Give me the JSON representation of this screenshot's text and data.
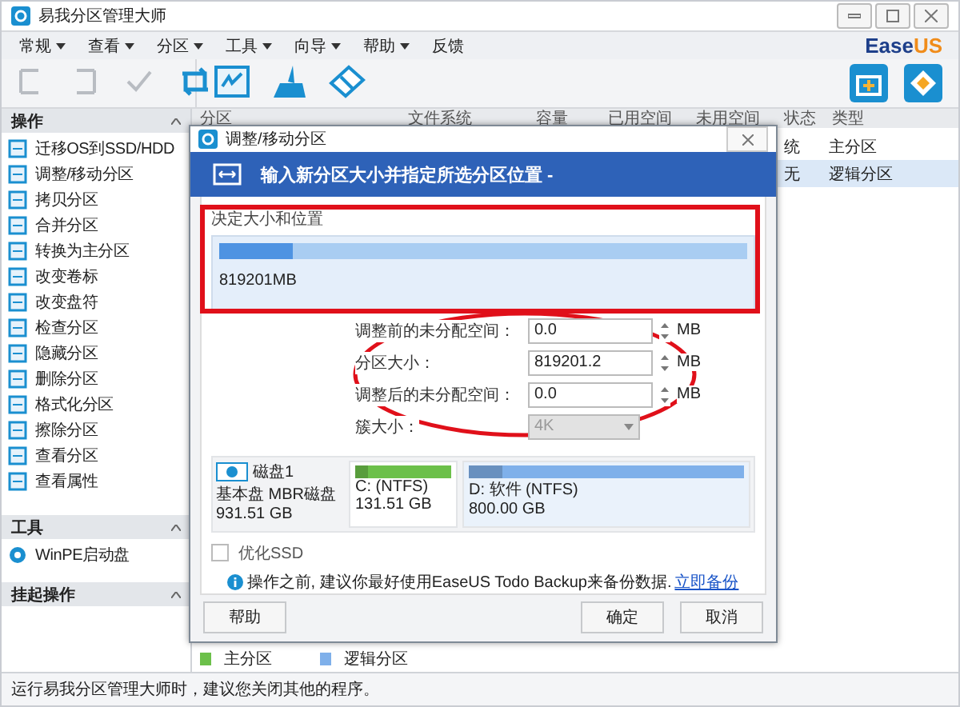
{
  "window": {
    "title": "易我分区管理大师"
  },
  "menu": [
    "常规",
    "查看",
    "分区",
    "工具",
    "向导",
    "帮助",
    "反馈"
  ],
  "logo": {
    "main": "Ease",
    "accent": "US"
  },
  "toolbar": [
    {
      "kind": "undo",
      "disabled": true
    },
    {
      "kind": "redo",
      "disabled": true
    },
    {
      "kind": "apply",
      "disabled": true
    },
    {
      "kind": "refresh",
      "disabled": false
    },
    {
      "kind": "migrate",
      "disabled": false
    },
    {
      "kind": "clean",
      "disabled": false
    },
    {
      "kind": "wipe",
      "disabled": false
    }
  ],
  "sidebar": [
    {
      "title": "操作",
      "items": [
        "迁移OS到SSD/HDD",
        "调整/移动分区",
        "拷贝分区",
        "合并分区",
        "转换为主分区",
        "改变卷标",
        "改变盘符",
        "检查分区",
        "隐藏分区",
        "删除分区",
        "格式化分区",
        "擦除分区",
        "查看分区",
        "查看属性"
      ]
    },
    {
      "title": "工具",
      "items": [
        "WinPE启动盘"
      ]
    },
    {
      "title": "挂起操作"
    }
  ],
  "table": {
    "columns": [
      "分区",
      "文件系统",
      "容量",
      "已用空间",
      "未用空间",
      "状态",
      "类型"
    ],
    "rows": [
      {
        "status": "统",
        "type": "主分区",
        "selected": false
      },
      {
        "status": "无",
        "type": "逻辑分区",
        "selected": true
      }
    ]
  },
  "legend": [
    {
      "label": "主分区",
      "color": "#6cc04a"
    },
    {
      "label": "逻辑分区",
      "color": "#7fb0ea"
    }
  ],
  "status_bar": "运行易我分区管理大师时，建议您关闭其他的程序。",
  "dialog": {
    "title": "调整/移动分区",
    "banner": "输入新分区大小并指定所选分区位置 -",
    "group_title": "决定大小和位置",
    "partition_bar": {
      "level": 0.14,
      "label": "819201MB"
    },
    "fields": [
      {
        "label": "调整前的未分配空间：",
        "value": "0.0",
        "unit": "MB",
        "kind": "spin"
      },
      {
        "label": "分区大小：",
        "value": "819201.2",
        "unit": "MB",
        "kind": "spin"
      },
      {
        "label": "调整后的未分配空间：",
        "value": "0.0",
        "unit": "MB",
        "kind": "spin"
      },
      {
        "label": "簇大小：",
        "value": "4K",
        "kind": "dropdown",
        "disabled": true
      }
    ],
    "disk": {
      "name": "磁盘1",
      "type": "基本盘 MBR磁盘",
      "size": "931.51 GB"
    },
    "partitions": [
      {
        "name": "C: (NTFS)",
        "size": "131.51 GB",
        "level": 0.13,
        "color": "#6cc04a",
        "selected": false
      },
      {
        "name": "D: 软件 (NTFS)",
        "size": "800.00 GB",
        "level": 0.12,
        "color": "#7fb0ea",
        "selected": true
      }
    ],
    "ssd_option": {
      "label": "优化SSD",
      "checked": false
    },
    "notice": "操作之前, 建议你最好使用EaseUS Todo Backup来备份数据.",
    "notice_link": "立即备份",
    "buttons": [
      {
        "label": "帮助",
        "kind": "help"
      },
      {
        "label": "确定",
        "kind": "ok"
      },
      {
        "label": "取消",
        "kind": "cancel"
      }
    ]
  }
}
